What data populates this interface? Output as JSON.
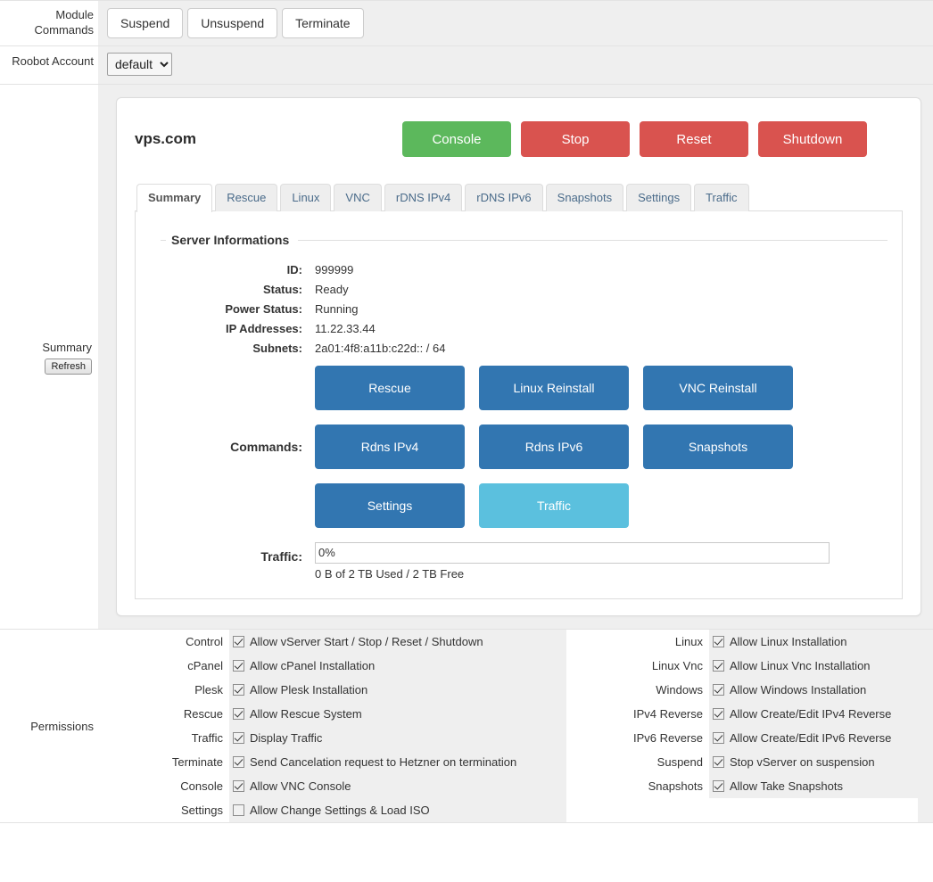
{
  "module_commands": {
    "label": "Module Commands",
    "buttons": [
      {
        "name": "suspend",
        "label": "Suspend"
      },
      {
        "name": "unsuspend",
        "label": "Unsuspend"
      },
      {
        "name": "terminate",
        "label": "Terminate"
      }
    ]
  },
  "roobot_account": {
    "label": "Roobot Account",
    "selected": "default",
    "options": [
      "default"
    ]
  },
  "summary": {
    "label": "Summary",
    "refresh_label": "Refresh",
    "panel": {
      "title": "vps.com",
      "actions": [
        {
          "name": "console",
          "label": "Console",
          "color": "#5cb85c"
        },
        {
          "name": "stop",
          "label": "Stop",
          "color": "#d9534f"
        },
        {
          "name": "reset",
          "label": "Reset",
          "color": "#d9534f"
        },
        {
          "name": "shutdown",
          "label": "Shutdown",
          "color": "#d9534f"
        }
      ],
      "tabs": [
        {
          "label": "Summary",
          "active": true
        },
        {
          "label": "Rescue",
          "active": false
        },
        {
          "label": "Linux",
          "active": false
        },
        {
          "label": "VNC",
          "active": false
        },
        {
          "label": "rDNS IPv4",
          "active": false
        },
        {
          "label": "rDNS IPv6",
          "active": false
        },
        {
          "label": "Snapshots",
          "active": false
        },
        {
          "label": "Settings",
          "active": false
        },
        {
          "label": "Traffic",
          "active": false
        }
      ],
      "server_info": {
        "legend": "Server Informations",
        "rows": [
          {
            "key": "ID:",
            "value": "999999",
            "status": false
          },
          {
            "key": "Status:",
            "value": "Ready",
            "status": true
          },
          {
            "key": "Power Status:",
            "value": "Running",
            "status": true
          },
          {
            "key": "IP Addresses:",
            "value": "11.22.33.44",
            "status": false
          },
          {
            "key": "Subnets:",
            "value": "2a01:4f8:a11b:c22d:: / 64",
            "status": false
          }
        ]
      },
      "commands": {
        "label": "Commands:",
        "buttons": [
          {
            "name": "rescue",
            "label": "Rescue",
            "color": "#3276b1"
          },
          {
            "name": "linux-reinstall",
            "label": "Linux Reinstall",
            "color": "#3276b1"
          },
          {
            "name": "vnc-reinstall",
            "label": "VNC Reinstall",
            "color": "#3276b1"
          },
          {
            "name": "rdns-ipv4",
            "label": "Rdns IPv4",
            "color": "#3276b1"
          },
          {
            "name": "rdns-ipv6",
            "label": "Rdns IPv6",
            "color": "#3276b1"
          },
          {
            "name": "snapshots",
            "label": "Snapshots",
            "color": "#3276b1"
          },
          {
            "name": "settings",
            "label": "Settings",
            "color": "#3276b1"
          },
          {
            "name": "traffic",
            "label": "Traffic",
            "color": "#5bc0de"
          }
        ]
      },
      "traffic": {
        "label": "Traffic:",
        "percent_text": "0%",
        "percent_value": 0,
        "note": "0 B of 2 TB Used / 2 TB Free"
      }
    }
  },
  "permissions": {
    "label": "Permissions",
    "left": [
      {
        "label": "Control",
        "text": "Allow vServer Start / Stop / Reset / Shutdown",
        "checked": true
      },
      {
        "label": "cPanel",
        "text": "Allow cPanel Installation",
        "checked": true
      },
      {
        "label": "Plesk",
        "text": "Allow Plesk Installation",
        "checked": true
      },
      {
        "label": "Rescue",
        "text": "Allow Rescue System",
        "checked": true
      },
      {
        "label": "Traffic",
        "text": "Display Traffic",
        "checked": true
      },
      {
        "label": "Terminate",
        "text": "Send Cancelation request to Hetzner on termination",
        "checked": true
      },
      {
        "label": "Console",
        "text": "Allow VNC Console",
        "checked": true
      },
      {
        "label": "Settings",
        "text": "Allow Change Settings & Load ISO",
        "checked": false
      }
    ],
    "right": [
      {
        "label": "Linux",
        "text": "Allow Linux Installation",
        "checked": true
      },
      {
        "label": "Linux Vnc",
        "text": "Allow Linux Vnc Installation",
        "checked": true
      },
      {
        "label": "Windows",
        "text": "Allow Windows Installation",
        "checked": true
      },
      {
        "label": "IPv4 Reverse",
        "text": "Allow Create/Edit IPv4 Reverse",
        "checked": true
      },
      {
        "label": "IPv6 Reverse",
        "text": "Allow Create/Edit IPv6 Reverse",
        "checked": true
      },
      {
        "label": "Suspend",
        "text": "Stop vServer on suspension",
        "checked": true
      },
      {
        "label": "Snapshots",
        "text": "Allow Take Snapshots",
        "checked": true
      }
    ]
  }
}
